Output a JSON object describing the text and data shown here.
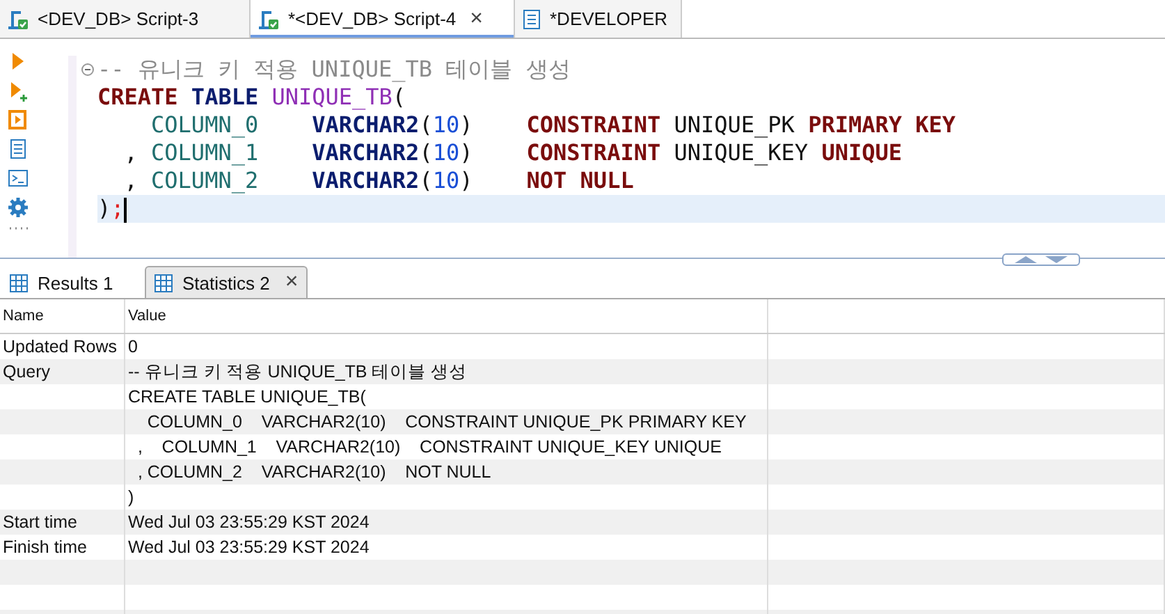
{
  "editor_tabs": [
    {
      "label": "<DEV_DB> Script-3",
      "kind": "script",
      "selected": false,
      "closable": false
    },
    {
      "label": "*<DEV_DB> Script-4",
      "kind": "script",
      "selected": true,
      "closable": true
    },
    {
      "label": "*DEVELOPER",
      "kind": "document",
      "selected": false,
      "closable": false
    }
  ],
  "close_glyph": "×",
  "code_lines": [
    {
      "current": false,
      "tokens": [
        {
          "kind": "comment",
          "text": "-- 유니크 키 적용 UNIQUE_TB 테이블 생성"
        }
      ]
    },
    {
      "current": false,
      "tokens": [
        {
          "kind": "keyword",
          "text": "CREATE"
        },
        {
          "kind": "type",
          "text": " TABLE"
        },
        {
          "kind": "table",
          "text": " UNIQUE_TB"
        },
        {
          "kind": "plain",
          "text": "("
        }
      ]
    },
    {
      "current": false,
      "tokens": [
        {
          "kind": "column",
          "text": "    COLUMN_0"
        },
        {
          "kind": "type",
          "text": "    VARCHAR2"
        },
        {
          "kind": "plain",
          "text": "("
        },
        {
          "kind": "number",
          "text": "10"
        },
        {
          "kind": "plain",
          "text": ")    "
        },
        {
          "kind": "keyword",
          "text": "CONSTRAINT"
        },
        {
          "kind": "plain",
          "text": " UNIQUE_PK "
        },
        {
          "kind": "keyword",
          "text": "PRIMARY KEY"
        }
      ]
    },
    {
      "current": false,
      "tokens": [
        {
          "kind": "plain",
          "text": "  , "
        },
        {
          "kind": "column",
          "text": "COLUMN_1"
        },
        {
          "kind": "type",
          "text": "    VARCHAR2"
        },
        {
          "kind": "plain",
          "text": "("
        },
        {
          "kind": "number",
          "text": "10"
        },
        {
          "kind": "plain",
          "text": ")    "
        },
        {
          "kind": "keyword",
          "text": "CONSTRAINT"
        },
        {
          "kind": "plain",
          "text": " UNIQUE_KEY "
        },
        {
          "kind": "keyword",
          "text": "UNIQUE"
        }
      ]
    },
    {
      "current": false,
      "tokens": [
        {
          "kind": "plain",
          "text": "  , "
        },
        {
          "kind": "column",
          "text": "COLUMN_2"
        },
        {
          "kind": "type",
          "text": "    VARCHAR2"
        },
        {
          "kind": "plain",
          "text": "("
        },
        {
          "kind": "number",
          "text": "10"
        },
        {
          "kind": "plain",
          "text": ")    "
        },
        {
          "kind": "keyword",
          "text": "NOT NULL"
        }
      ]
    },
    {
      "current": true,
      "tokens": [
        {
          "kind": "plain",
          "text": ")"
        },
        {
          "kind": "delimiter",
          "text": ";"
        }
      ]
    }
  ],
  "result_tabs": [
    {
      "label": "Results 1",
      "selected": false,
      "closable": false
    },
    {
      "label": "Statistics 2",
      "selected": true,
      "closable": true
    }
  ],
  "table": {
    "columns": [
      "Name",
      "Value"
    ],
    "rows": [
      {
        "name": "Updated Rows",
        "lines": [
          "0"
        ]
      },
      {
        "name": "Query",
        "lines": [
          "-- 유니크 키 적용 UNIQUE_TB 테이블 생성",
          "CREATE TABLE UNIQUE_TB(",
          "    COLUMN_0    VARCHAR2(10)    CONSTRAINT UNIQUE_PK PRIMARY KEY",
          "  ,    COLUMN_1    VARCHAR2(10)    CONSTRAINT UNIQUE_KEY UNIQUE",
          "  , COLUMN_2    VARCHAR2(10)    NOT NULL",
          ")"
        ]
      },
      {
        "name": "Start time",
        "lines": [
          "Wed Jul 03 23:55:29 KST 2024"
        ]
      },
      {
        "name": "Finish time",
        "lines": [
          "Wed Jul 03 23:55:29 KST 2024"
        ]
      }
    ]
  }
}
